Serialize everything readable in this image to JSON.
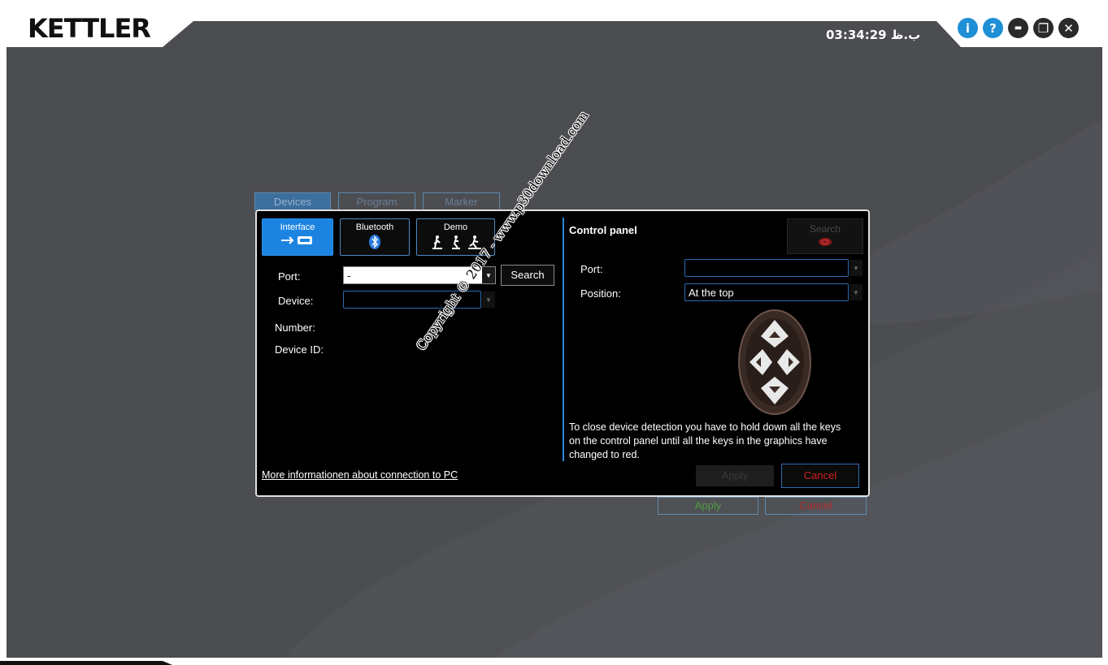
{
  "app": {
    "logo": "KETTLER",
    "clock": "03:34:29 ب.ظ",
    "window_buttons": [
      {
        "icon": "info-icon",
        "glyph": "i"
      },
      {
        "icon": "help-icon",
        "glyph": "?"
      },
      {
        "icon": "minimize-icon",
        "glyph": "▬"
      },
      {
        "icon": "restore-icon",
        "glyph": "❐"
      },
      {
        "icon": "close-icon",
        "glyph": "✕"
      }
    ]
  },
  "background": {
    "tabs": [
      "Devices",
      "Program",
      "Marker"
    ],
    "apply_label": "Apply",
    "cancel_label": "Cancel"
  },
  "dialog": {
    "modes": [
      {
        "label": "Interface",
        "icon": "usb-serial-icon",
        "glyph": "⟜ ▭"
      },
      {
        "label": "Bluetooth",
        "icon": "bluetooth-icon",
        "glyph": "ᛒ"
      },
      {
        "label": "Demo",
        "icon": "fitness-devices-icon",
        "glyph": "🚴 🏃 🏋"
      }
    ],
    "port_label": "Port:",
    "port_value": "-",
    "search_label": "Search",
    "device_label": "Device:",
    "device_value": "",
    "number_label": "Number:",
    "device_id_label": "Device ID:",
    "more_info_link": "More informationen about connection to PC",
    "watermark": "Copyright © 2017 - www.p30download.com",
    "control_panel": {
      "title": "Control panel",
      "search_label": "Search",
      "port_label": "Port:",
      "port_value": "",
      "position_label": "Position:",
      "position_value": "At the top",
      "info_text": "To close device detection you have to hold down all the keys on the control panel until all the keys in the graphics have changed to red.",
      "apply_label": "Apply",
      "cancel_label": "Cancel"
    }
  },
  "colors": {
    "accent_blue": "#1c84e0",
    "border_blue": "#2f6bb1",
    "cancel_red": "#d42020",
    "apply_green": "#5aa34a"
  }
}
